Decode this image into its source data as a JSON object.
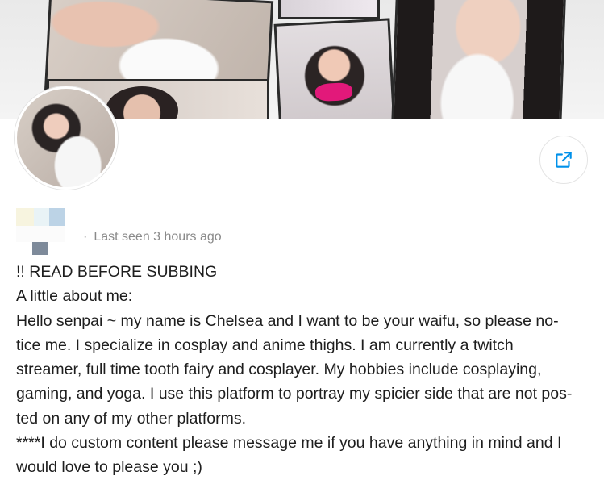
{
  "profile": {
    "last_seen": "Last seen 3 hours ago",
    "separator": "·",
    "share_icon": "share-icon"
  },
  "bio": {
    "lines": [
      "!! READ BEFORE SUBBING",
      "A little about me:",
      "Hello senpai ~ my name is Chelsea and I want to be your waifu, so please no-",
      "tice me. I specialize in cosplay and anime thighs. I am currently a twitch",
      "streamer, full time tooth fairy and cosplayer. My hobbies include cosplaying,",
      "gaming, and yoga. I use this platform to portray my spicier side that are not pos-",
      "ted on any of my other platforms.",
      "****I do custom content please message me if you have anything in mind and I",
      "would love to please you ;)"
    ]
  },
  "colors": {
    "accent": "#0091ea",
    "muted_text": "#8a8a8a",
    "body_text": "#1e1e1e"
  }
}
